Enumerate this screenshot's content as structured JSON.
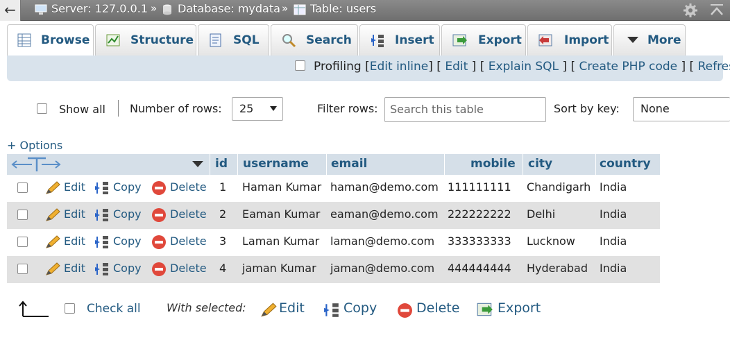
{
  "breadcrumb": {
    "server": "Server: 127.0.0.1",
    "database": "Database: mydata",
    "table": "Table: users",
    "separator": "»"
  },
  "tabs": [
    {
      "label": "Browse",
      "icon": "browse-icon"
    },
    {
      "label": "Structure",
      "icon": "structure-icon"
    },
    {
      "label": "SQL",
      "icon": "sql-icon"
    },
    {
      "label": "Search",
      "icon": "search-icon"
    },
    {
      "label": "Insert",
      "icon": "insert-icon"
    },
    {
      "label": "Export",
      "icon": "export-icon"
    },
    {
      "label": "Import",
      "icon": "import-icon"
    },
    {
      "label": "More",
      "icon": "caret-down-icon"
    }
  ],
  "profiling": {
    "label": "Profiling",
    "links": [
      "Edit inline",
      "Edit",
      "Explain SQL",
      "Create PHP code",
      "Refresh"
    ]
  },
  "controls": {
    "show_all": "Show all",
    "num_rows_label": "Number of rows:",
    "num_rows_value": "25",
    "filter_label": "Filter rows:",
    "filter_placeholder": "Search this table",
    "sort_label": "Sort by key:",
    "sort_value": "None",
    "options": "+ Options"
  },
  "table": {
    "columns": [
      "id",
      "username",
      "email",
      "mobile",
      "city",
      "country"
    ],
    "actions": {
      "edit": "Edit",
      "copy": "Copy",
      "delete": "Delete"
    },
    "rows": [
      {
        "id": "1",
        "username": "Haman Kumar",
        "email": "haman@demo.com",
        "mobile": "111111111",
        "city": "Chandigarh",
        "country": "India"
      },
      {
        "id": "2",
        "username": "Eaman Kumar",
        "email": "eaman@demo.com",
        "mobile": "222222222",
        "city": "Delhi",
        "country": "India"
      },
      {
        "id": "3",
        "username": "Laman Kumar",
        "email": "laman@demo.com",
        "mobile": "333333333",
        "city": "Lucknow",
        "country": "India"
      },
      {
        "id": "4",
        "username": "jaman Kumar",
        "email": "jaman@demo.com",
        "mobile": "444444444",
        "city": "Hyderabad",
        "country": "India"
      }
    ]
  },
  "bottom": {
    "check_all": "Check all",
    "with_selected": "With selected:",
    "edit": "Edit",
    "copy": "Copy",
    "delete": "Delete",
    "export": "Export"
  },
  "colors": {
    "link": "#235a81",
    "header_bg": "#d5dfe8",
    "delete_red": "#e0483b"
  }
}
